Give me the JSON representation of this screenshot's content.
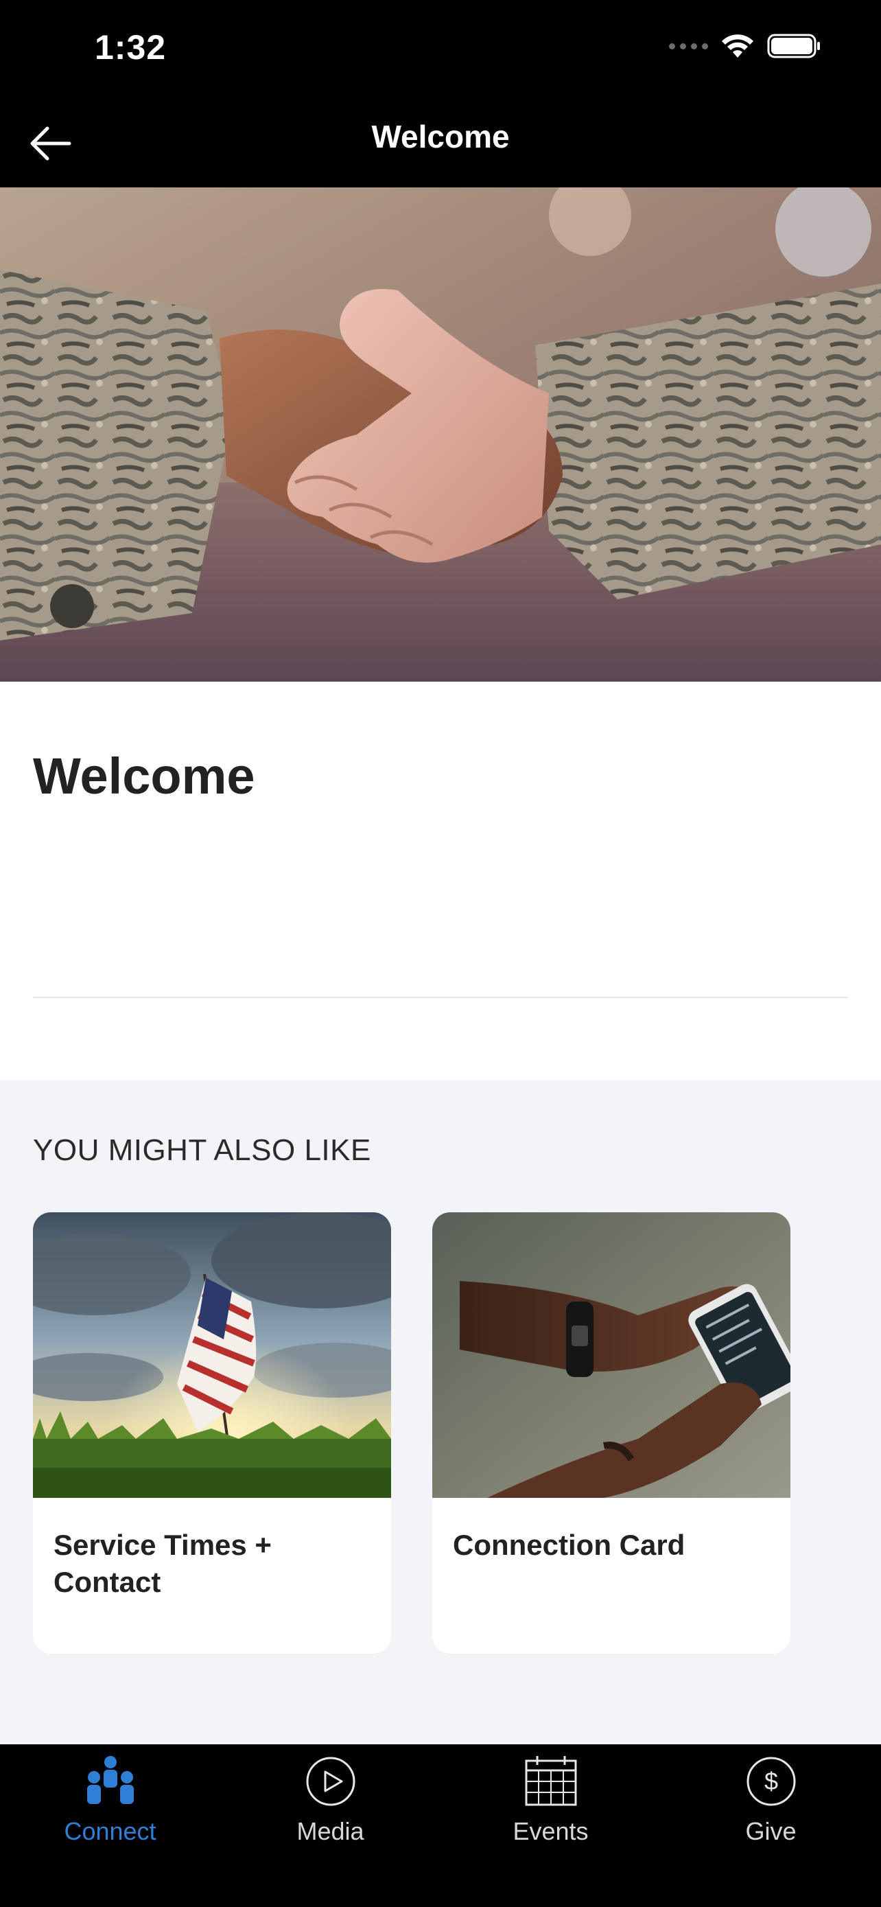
{
  "status_bar": {
    "time": "1:32"
  },
  "nav": {
    "title": "Welcome"
  },
  "content": {
    "title": "Welcome"
  },
  "related": {
    "heading": "YOU MIGHT ALSO LIKE",
    "cards": [
      {
        "label": "Service Times + Contact",
        "image": "american-flag-sunset"
      },
      {
        "label": "Connection Card",
        "image": "hands-holding-phone"
      }
    ]
  },
  "tabs": [
    {
      "label": "Connect",
      "icon": "people-icon",
      "active": true
    },
    {
      "label": "Media",
      "icon": "play-icon",
      "active": false
    },
    {
      "label": "Events",
      "icon": "calendar-icon",
      "active": false
    },
    {
      "label": "Give",
      "icon": "dollar-icon",
      "active": false
    }
  ],
  "colors": {
    "accent": "#2f7fd7",
    "background": "#f3f4f8",
    "bar": "#000000"
  }
}
